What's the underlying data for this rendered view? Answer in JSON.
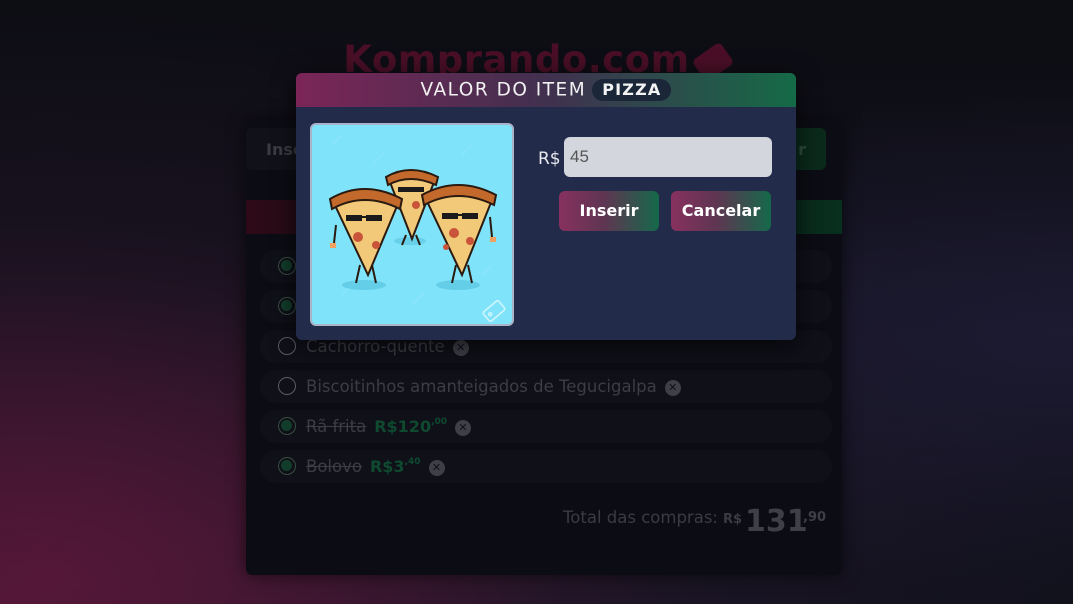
{
  "app": {
    "title": "Komprando.com"
  },
  "insert_bar": {
    "label": "Inse",
    "button_label": "r"
  },
  "items": [
    {
      "name": "",
      "checked": true,
      "done": false,
      "price_main": "",
      "price_cents": ""
    },
    {
      "name": "",
      "checked": true,
      "done": false,
      "price_main": "",
      "price_cents": ""
    },
    {
      "name": "Cachorro-quente",
      "checked": false,
      "done": false,
      "price_main": "",
      "price_cents": ""
    },
    {
      "name": "Biscoitinhos amanteigados de Tegucigalpa",
      "checked": false,
      "done": false,
      "price_main": "",
      "price_cents": ""
    },
    {
      "name": "Rã frita",
      "checked": true,
      "done": true,
      "price_main": "R$120",
      "price_cents": ",00"
    },
    {
      "name": "Bolovo",
      "checked": true,
      "done": true,
      "price_main": "R$3",
      "price_cents": ",40"
    }
  ],
  "total": {
    "label": "Total das compras:",
    "currency": "R$",
    "value": "131",
    "cents": ",90"
  },
  "modal": {
    "title": "VALOR DO ITEM",
    "item_name": "PIZZA",
    "currency_label": "R$",
    "input_value": "45",
    "insert_label": "Inserir",
    "cancel_label": "Cancelar",
    "image_icon": "pizza-slices-illustration"
  },
  "colors": {
    "accent_pink": "#87315f",
    "accent_green": "#15694a",
    "modal_bg": "#222c4a"
  }
}
